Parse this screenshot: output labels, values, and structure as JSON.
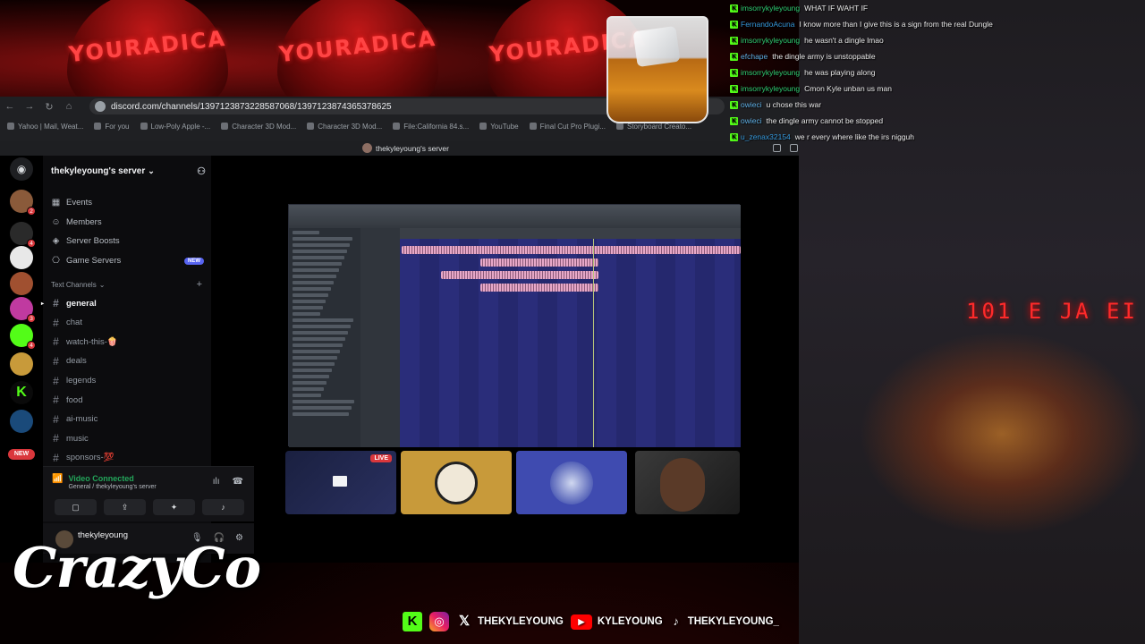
{
  "browser": {
    "url": "discord.com/channels/1397123873228587068/1397123874365378625",
    "bookmarks": [
      "Yahoo | Mail, Weat...",
      "For you",
      "Low-Poly Apple -...",
      "Character 3D Mod...",
      "Character 3D Mod...",
      "File:California 84.s...",
      "YouTube",
      "Final Cut Pro Plugi...",
      "Storyboard Creato..."
    ],
    "tab_title": "thekyleyoung's server"
  },
  "overlay": {
    "cap_text": "YOURADICA",
    "brand": "CrazyCo",
    "led_text": "101 E JA EI"
  },
  "server": {
    "name": "thekyleyoung's server",
    "nav": [
      {
        "icon": "calendar-icon",
        "label": "Events"
      },
      {
        "icon": "members-icon",
        "label": "Members"
      },
      {
        "icon": "boost-icon",
        "label": "Server Boosts"
      },
      {
        "icon": "gamepad-icon",
        "label": "Game Servers",
        "tag": "NEW"
      }
    ],
    "category": "Text Channels",
    "channels": [
      "general",
      "chat",
      "watch-this-🍿",
      "deals",
      "legends",
      "food",
      "ai-music",
      "music",
      "sponsors-💯"
    ]
  },
  "guilds": {
    "badges": [
      "2",
      "4",
      "3",
      "4"
    ],
    "new_label": "NEW"
  },
  "voice": {
    "status": "Video Connected",
    "location": "General / thekyleyoung's server"
  },
  "user": {
    "name": "thekyleyoung"
  },
  "stream": {
    "live_label": "LIVE"
  },
  "chat": [
    {
      "user": "imsorrykyleyoung",
      "color": "#2ecc71",
      "text": "WHAT IF WAHT IF"
    },
    {
      "user": "FernandoAcuna",
      "color": "#3498db",
      "text": "I know more than I give this is a sign from the real Dungle"
    },
    {
      "user": "imsorrykyleyoung",
      "color": "#2ecc71",
      "text": "he wasn't a dingle lmao"
    },
    {
      "user": "efchape",
      "color": "#5dade2",
      "text": "the dingle army is unstoppable"
    },
    {
      "user": "imsorrykyleyoung",
      "color": "#2ecc71",
      "text": "he was playing along"
    },
    {
      "user": "imsorrykyleyoung",
      "color": "#2ecc71",
      "text": "Cmon Kyle unban us man"
    },
    {
      "user": "owieci",
      "color": "#5dade2",
      "text": "u chose this war"
    },
    {
      "user": "owieci",
      "color": "#5dade2",
      "text": "the dingle army cannot be stopped"
    },
    {
      "user": "u_zenax32154",
      "color": "#3498db",
      "text": "we r every where like the irs nigguh"
    }
  ],
  "socials": [
    {
      "icon": "kick-icon",
      "label": ""
    },
    {
      "icon": "instagram-icon",
      "label": ""
    },
    {
      "icon": "x-icon",
      "label": "THEKYLEYOUNG"
    },
    {
      "icon": "youtube-icon",
      "label": "KYLEYOUNG"
    },
    {
      "icon": "tiktok-icon",
      "label": "THEKYLEYOUNG_"
    }
  ]
}
